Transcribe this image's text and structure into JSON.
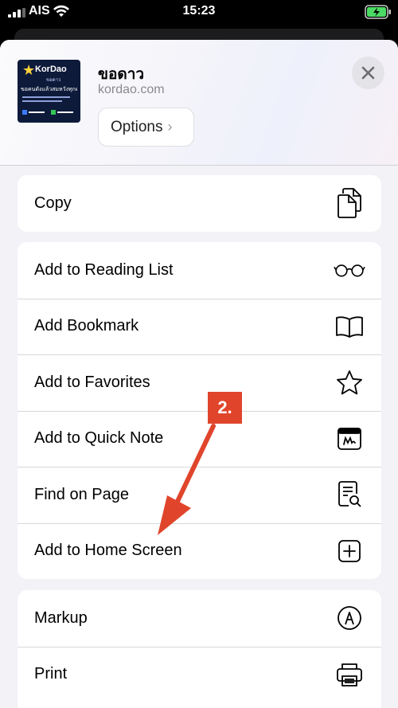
{
  "status_bar": {
    "carrier": "AIS",
    "time": "15:23"
  },
  "share_header": {
    "title": "ขอดาว",
    "url": "kordao.com",
    "options_label": "Options",
    "thumbnail": {
      "brand": "KorDao",
      "sub": "ขอดาว",
      "line": "ขอคนดังแล้วสมหวังทุกคน"
    }
  },
  "groups": [
    {
      "rows": [
        {
          "label": "Copy",
          "icon": "copy-icon"
        }
      ]
    },
    {
      "rows": [
        {
          "label": "Add to Reading List",
          "icon": "glasses-icon"
        },
        {
          "label": "Add Bookmark",
          "icon": "book-icon"
        },
        {
          "label": "Add to Favorites",
          "icon": "star-icon"
        },
        {
          "label": "Add to Quick Note",
          "icon": "quick-note-icon"
        },
        {
          "label": "Find on Page",
          "icon": "find-on-page-icon"
        },
        {
          "label": "Add to Home Screen",
          "icon": "add-square-icon"
        }
      ]
    },
    {
      "rows": [
        {
          "label": "Markup",
          "icon": "markup-icon"
        },
        {
          "label": "Print",
          "icon": "printer-icon"
        }
      ]
    }
  ],
  "annotation": {
    "step_label": "2.",
    "color": "#e0452c"
  }
}
